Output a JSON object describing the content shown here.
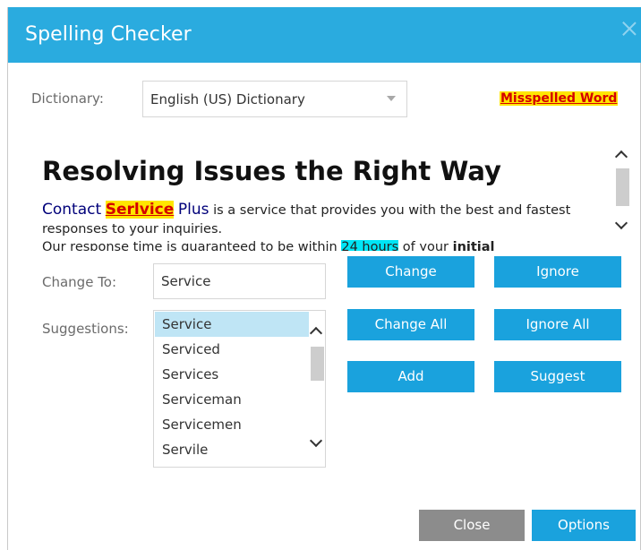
{
  "dialog": {
    "title": "Spelling Checker"
  },
  "dictionary": {
    "label": "Dictionary:",
    "selected": "English (US) Dictionary"
  },
  "legend": {
    "misspelled": "Misspelled Word"
  },
  "preview": {
    "heading": "Resolving Issues the Right Way",
    "p1": {
      "brand_a": "Contact",
      "misspelled": "Serlvice",
      "brand_b": "Plus",
      "rest": "is a service that provides you with the best and fastest responses to your inquiries."
    },
    "p2": {
      "before": "Our response time is guaranteed to be within",
      "highlight": "24 hours",
      "middle": "of your",
      "bold": "initial"
    }
  },
  "change_to": {
    "label": "Change To:",
    "value": "Service"
  },
  "suggestions": {
    "label": "Suggestions:",
    "items": [
      "Service",
      "Serviced",
      "Services",
      "Serviceman",
      "Servicemen",
      "Servile"
    ],
    "selected_index": 0
  },
  "buttons": {
    "change": "Change",
    "ignore": "Ignore",
    "change_all": "Change All",
    "ignore_all": "Ignore All",
    "add": "Add",
    "suggest": "Suggest",
    "close": "Close",
    "options": "Options"
  },
  "colors": {
    "titlebar": "#2aabdf",
    "button": "#1aa2dd",
    "close_button": "#8c8c8c",
    "misspelled_bg": "#ffe600",
    "misspelled_fg": "#d40000",
    "highlight": "#00e5f5",
    "selection": "#bfe5f5"
  }
}
